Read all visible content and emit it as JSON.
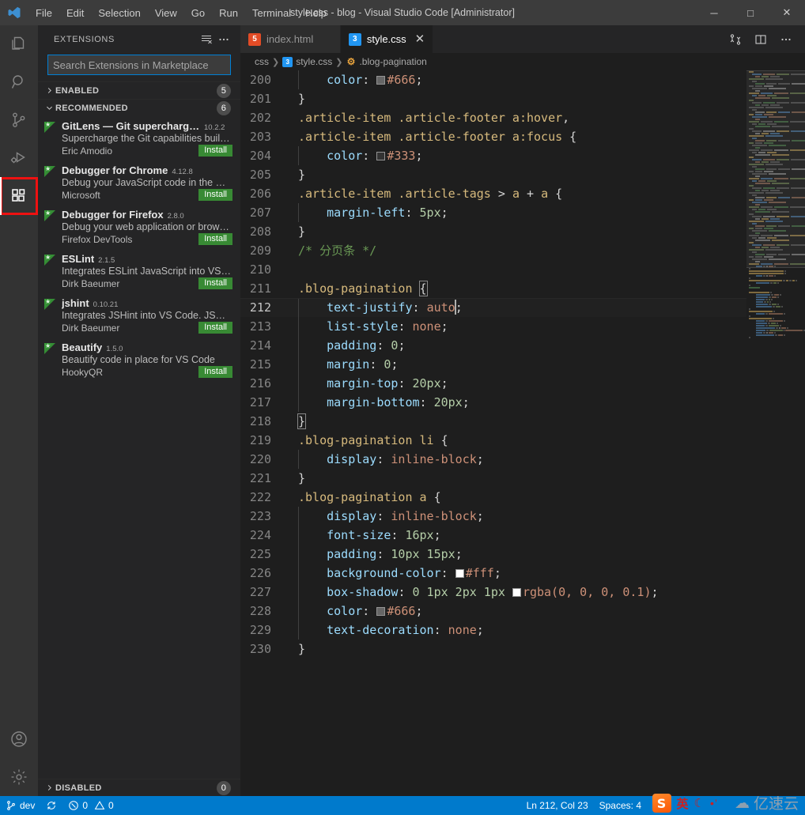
{
  "window": {
    "title": "style.css - blog - Visual Studio Code [Administrator]",
    "minimize_label": "─",
    "maximize_label": "□",
    "close_label": "✕"
  },
  "menubar": [
    {
      "label": "File"
    },
    {
      "label": "Edit"
    },
    {
      "label": "Selection"
    },
    {
      "label": "View"
    },
    {
      "label": "Go"
    },
    {
      "label": "Run"
    },
    {
      "label": "Terminal"
    },
    {
      "label": "Help"
    }
  ],
  "activitybar": [
    {
      "name": "explorer",
      "icon": "files-icon",
      "active": false
    },
    {
      "name": "search",
      "icon": "search-icon",
      "active": false
    },
    {
      "name": "source-control",
      "icon": "source-control-icon",
      "active": false
    },
    {
      "name": "run-debug",
      "icon": "run-debug-icon",
      "active": false
    },
    {
      "name": "extensions",
      "icon": "extensions-icon",
      "active": true,
      "highlighted": true
    },
    {
      "name": "accounts",
      "icon": "account-icon",
      "active": false
    },
    {
      "name": "manage",
      "icon": "gear-icon",
      "active": false
    }
  ],
  "sidebar": {
    "title": "EXTENSIONS",
    "actions": [
      {
        "name": "clear-extensions-input",
        "icon": "clear-filter-icon"
      },
      {
        "name": "views-and-more-actions",
        "icon": "ellipsis-icon"
      }
    ],
    "search": {
      "placeholder": "Search Extensions in Marketplace",
      "value": ""
    },
    "sections": [
      {
        "label": "ENABLED",
        "count": "5",
        "expanded": false
      },
      {
        "label": "RECOMMENDED",
        "count": "6",
        "expanded": true
      },
      {
        "label": "DISABLED",
        "count": "0",
        "expanded": false
      }
    ],
    "recommended": [
      {
        "name": "GitLens — Git supercharged",
        "version": "10.2.2",
        "description": "Supercharge the Git capabilities built i...",
        "publisher": "Eric Amodio",
        "install_label": "Install"
      },
      {
        "name": "Debugger for Chrome",
        "version": "4.12.8",
        "description": "Debug your JavaScript code in the Ch...",
        "publisher": "Microsoft",
        "install_label": "Install"
      },
      {
        "name": "Debugger for Firefox",
        "version": "2.8.0",
        "description": "Debug your web application or brows...",
        "publisher": "Firefox DevTools",
        "install_label": "Install"
      },
      {
        "name": "ESLint",
        "version": "2.1.5",
        "description": "Integrates ESLint JavaScript into VS C...",
        "publisher": "Dirk Baeumer",
        "install_label": "Install"
      },
      {
        "name": "jshint",
        "version": "0.10.21",
        "description": "Integrates JSHint into VS Code. JSHint...",
        "publisher": "Dirk Baeumer",
        "install_label": "Install"
      },
      {
        "name": "Beautify",
        "version": "1.5.0",
        "description": "Beautify code in place for VS Code",
        "publisher": "HookyQR",
        "install_label": "Install"
      }
    ]
  },
  "editor": {
    "tabs": [
      {
        "label": "index.html",
        "icon": "html5-icon",
        "active": false,
        "close_label": "✕"
      },
      {
        "label": "style.css",
        "icon": "css3-icon",
        "active": true,
        "close_label": "✕"
      }
    ],
    "actions": [
      {
        "name": "open-changes",
        "icon": "compare-changes-icon"
      },
      {
        "name": "split-editor",
        "icon": "split-editor-icon"
      },
      {
        "name": "more-actions",
        "icon": "ellipsis-icon"
      }
    ],
    "breadcrumbs": [
      {
        "label": "css",
        "icon": "folder"
      },
      {
        "label": "style.css",
        "icon": "css3-icon"
      },
      {
        "label": ".blog-pagination",
        "icon": "css-symbol-icon"
      }
    ],
    "first_line": 200,
    "lines": [
      {
        "n": 200,
        "indent": true,
        "tokens": [
          {
            "t": "    ",
            "c": "tk-punc"
          },
          {
            "t": "color",
            "c": "tk-prop"
          },
          {
            "t": ": ",
            "c": "tk-punc"
          },
          {
            "t": "■",
            "c": "colorbox",
            "color": "#666666"
          },
          {
            "t": "#666",
            "c": "tk-val"
          },
          {
            "t": ";",
            "c": "tk-punc"
          }
        ]
      },
      {
        "n": 201,
        "indent": false,
        "tokens": [
          {
            "t": "}",
            "c": "tk-brace"
          }
        ]
      },
      {
        "n": 202,
        "indent": false,
        "tokens": [
          {
            "t": ".article-item .article-footer a:hover",
            "c": "tk-sel"
          },
          {
            "t": ",",
            "c": "tk-punc"
          }
        ]
      },
      {
        "n": 203,
        "indent": false,
        "tokens": [
          {
            "t": ".article-item .article-footer a:focus ",
            "c": "tk-sel"
          },
          {
            "t": "{",
            "c": "tk-brace"
          }
        ]
      },
      {
        "n": 204,
        "indent": true,
        "tokens": [
          {
            "t": "    ",
            "c": "tk-punc"
          },
          {
            "t": "color",
            "c": "tk-prop"
          },
          {
            "t": ": ",
            "c": "tk-punc"
          },
          {
            "t": "■",
            "c": "colorbox",
            "color": "#333333"
          },
          {
            "t": "#333",
            "c": "tk-val"
          },
          {
            "t": ";",
            "c": "tk-punc"
          }
        ]
      },
      {
        "n": 205,
        "indent": false,
        "tokens": [
          {
            "t": "}",
            "c": "tk-brace"
          }
        ]
      },
      {
        "n": 206,
        "indent": false,
        "tokens": [
          {
            "t": ".article-item .article-tags ",
            "c": "tk-sel"
          },
          {
            "t": "> ",
            "c": "tk-punc"
          },
          {
            "t": "a ",
            "c": "tk-sel"
          },
          {
            "t": "+ ",
            "c": "tk-punc"
          },
          {
            "t": "a ",
            "c": "tk-sel"
          },
          {
            "t": "{",
            "c": "tk-brace"
          }
        ]
      },
      {
        "n": 207,
        "indent": true,
        "tokens": [
          {
            "t": "    ",
            "c": "tk-punc"
          },
          {
            "t": "margin-left",
            "c": "tk-prop"
          },
          {
            "t": ": ",
            "c": "tk-punc"
          },
          {
            "t": "5px",
            "c": "tk-num"
          },
          {
            "t": ";",
            "c": "tk-punc"
          }
        ]
      },
      {
        "n": 208,
        "indent": false,
        "tokens": [
          {
            "t": "}",
            "c": "tk-brace"
          }
        ]
      },
      {
        "n": 209,
        "indent": false,
        "tokens": [
          {
            "t": "/* 分页条 */",
            "c": "tk-com"
          }
        ]
      },
      {
        "n": 210,
        "indent": false,
        "tokens": []
      },
      {
        "n": 211,
        "indent": false,
        "tokens": [
          {
            "t": ".blog-pagination ",
            "c": "tk-sel"
          },
          {
            "t": "{",
            "c": "tk-brace-hl"
          }
        ]
      },
      {
        "n": 212,
        "indent": true,
        "current": true,
        "tokens": [
          {
            "t": "    ",
            "c": "tk-punc"
          },
          {
            "t": "text-justify",
            "c": "tk-prop"
          },
          {
            "t": ": ",
            "c": "tk-punc"
          },
          {
            "t": "auto",
            "c": "tk-val"
          },
          {
            "t": ";",
            "c": "tk-punc"
          }
        ]
      },
      {
        "n": 213,
        "indent": true,
        "tokens": [
          {
            "t": "    ",
            "c": "tk-punc"
          },
          {
            "t": "list-style",
            "c": "tk-prop"
          },
          {
            "t": ": ",
            "c": "tk-punc"
          },
          {
            "t": "none",
            "c": "tk-val"
          },
          {
            "t": ";",
            "c": "tk-punc"
          }
        ]
      },
      {
        "n": 214,
        "indent": true,
        "tokens": [
          {
            "t": "    ",
            "c": "tk-punc"
          },
          {
            "t": "padding",
            "c": "tk-prop"
          },
          {
            "t": ": ",
            "c": "tk-punc"
          },
          {
            "t": "0",
            "c": "tk-num"
          },
          {
            "t": ";",
            "c": "tk-punc"
          }
        ]
      },
      {
        "n": 215,
        "indent": true,
        "tokens": [
          {
            "t": "    ",
            "c": "tk-punc"
          },
          {
            "t": "margin",
            "c": "tk-prop"
          },
          {
            "t": ": ",
            "c": "tk-punc"
          },
          {
            "t": "0",
            "c": "tk-num"
          },
          {
            "t": ";",
            "c": "tk-punc"
          }
        ]
      },
      {
        "n": 216,
        "indent": true,
        "tokens": [
          {
            "t": "    ",
            "c": "tk-punc"
          },
          {
            "t": "margin-top",
            "c": "tk-prop"
          },
          {
            "t": ": ",
            "c": "tk-punc"
          },
          {
            "t": "20px",
            "c": "tk-num"
          },
          {
            "t": ";",
            "c": "tk-punc"
          }
        ]
      },
      {
        "n": 217,
        "indent": true,
        "tokens": [
          {
            "t": "    ",
            "c": "tk-punc"
          },
          {
            "t": "margin-bottom",
            "c": "tk-prop"
          },
          {
            "t": ": ",
            "c": "tk-punc"
          },
          {
            "t": "20px",
            "c": "tk-num"
          },
          {
            "t": ";",
            "c": "tk-punc"
          }
        ]
      },
      {
        "n": 218,
        "indent": false,
        "tokens": [
          {
            "t": "}",
            "c": "tk-brace-hl"
          }
        ]
      },
      {
        "n": 219,
        "indent": false,
        "tokens": [
          {
            "t": ".blog-pagination li ",
            "c": "tk-sel"
          },
          {
            "t": "{",
            "c": "tk-brace"
          }
        ]
      },
      {
        "n": 220,
        "indent": true,
        "tokens": [
          {
            "t": "    ",
            "c": "tk-punc"
          },
          {
            "t": "display",
            "c": "tk-prop"
          },
          {
            "t": ": ",
            "c": "tk-punc"
          },
          {
            "t": "inline-block",
            "c": "tk-val"
          },
          {
            "t": ";",
            "c": "tk-punc"
          }
        ]
      },
      {
        "n": 221,
        "indent": false,
        "tokens": [
          {
            "t": "}",
            "c": "tk-brace"
          }
        ]
      },
      {
        "n": 222,
        "indent": false,
        "tokens": [
          {
            "t": ".blog-pagination a ",
            "c": "tk-sel"
          },
          {
            "t": "{",
            "c": "tk-brace"
          }
        ]
      },
      {
        "n": 223,
        "indent": true,
        "tokens": [
          {
            "t": "    ",
            "c": "tk-punc"
          },
          {
            "t": "display",
            "c": "tk-prop"
          },
          {
            "t": ": ",
            "c": "tk-punc"
          },
          {
            "t": "inline-block",
            "c": "tk-val"
          },
          {
            "t": ";",
            "c": "tk-punc"
          }
        ]
      },
      {
        "n": 224,
        "indent": true,
        "tokens": [
          {
            "t": "    ",
            "c": "tk-punc"
          },
          {
            "t": "font-size",
            "c": "tk-prop"
          },
          {
            "t": ": ",
            "c": "tk-punc"
          },
          {
            "t": "16px",
            "c": "tk-num"
          },
          {
            "t": ";",
            "c": "tk-punc"
          }
        ]
      },
      {
        "n": 225,
        "indent": true,
        "tokens": [
          {
            "t": "    ",
            "c": "tk-punc"
          },
          {
            "t": "padding",
            "c": "tk-prop"
          },
          {
            "t": ": ",
            "c": "tk-punc"
          },
          {
            "t": "10px 15px",
            "c": "tk-num"
          },
          {
            "t": ";",
            "c": "tk-punc"
          }
        ]
      },
      {
        "n": 226,
        "indent": true,
        "tokens": [
          {
            "t": "    ",
            "c": "tk-punc"
          },
          {
            "t": "background-color",
            "c": "tk-prop"
          },
          {
            "t": ": ",
            "c": "tk-punc"
          },
          {
            "t": "■",
            "c": "colorbox",
            "color": "#ffffff"
          },
          {
            "t": "#fff",
            "c": "tk-val"
          },
          {
            "t": ";",
            "c": "tk-punc"
          }
        ]
      },
      {
        "n": 227,
        "indent": true,
        "tokens": [
          {
            "t": "    ",
            "c": "tk-punc"
          },
          {
            "t": "box-shadow",
            "c": "tk-prop"
          },
          {
            "t": ": ",
            "c": "tk-punc"
          },
          {
            "t": "0 1px 2px 1px ",
            "c": "tk-num"
          },
          {
            "t": "■",
            "c": "colorbox",
            "color": "#ffffff"
          },
          {
            "t": "rgba(0, 0, 0, 0.1)",
            "c": "tk-val"
          },
          {
            "t": ";",
            "c": "tk-punc"
          }
        ]
      },
      {
        "n": 228,
        "indent": true,
        "tokens": [
          {
            "t": "    ",
            "c": "tk-punc"
          },
          {
            "t": "color",
            "c": "tk-prop"
          },
          {
            "t": ": ",
            "c": "tk-punc"
          },
          {
            "t": "■",
            "c": "colorbox",
            "color": "#666666"
          },
          {
            "t": "#666",
            "c": "tk-val"
          },
          {
            "t": ";",
            "c": "tk-punc"
          }
        ]
      },
      {
        "n": 229,
        "indent": true,
        "tokens": [
          {
            "t": "    ",
            "c": "tk-punc"
          },
          {
            "t": "text-decoration",
            "c": "tk-prop"
          },
          {
            "t": ": ",
            "c": "tk-punc"
          },
          {
            "t": "none",
            "c": "tk-val"
          },
          {
            "t": ";",
            "c": "tk-punc"
          }
        ]
      },
      {
        "n": 230,
        "indent": false,
        "tokens": [
          {
            "t": "}",
            "c": "tk-brace"
          }
        ]
      }
    ]
  },
  "statusbar": {
    "left": [
      {
        "name": "branch",
        "icon": "source-control-icon",
        "label": "dev"
      },
      {
        "name": "sync",
        "icon": "sync-icon",
        "label": ""
      },
      {
        "name": "problems",
        "icon": "error-warning-icon",
        "label": "0",
        "label2": "0"
      }
    ],
    "right": [
      {
        "name": "cursor-position",
        "label": "Ln 212, Col 23"
      },
      {
        "name": "indentation",
        "label": "Spaces: 4"
      }
    ]
  },
  "overlay": {
    "ime": {
      "logo": "S",
      "mode": "英",
      "moon": "☾",
      "dots": "•’"
    },
    "watermark": {
      "cloud": "☁",
      "text": "亿速云"
    }
  },
  "colors": {
    "accent": "#007acc",
    "titlebar": "#3c3c3c",
    "sidebar": "#252526",
    "activitybar": "#333333",
    "editor": "#1e1e1e",
    "install_green": "#388a34",
    "highlight_red": "#ee1111"
  }
}
